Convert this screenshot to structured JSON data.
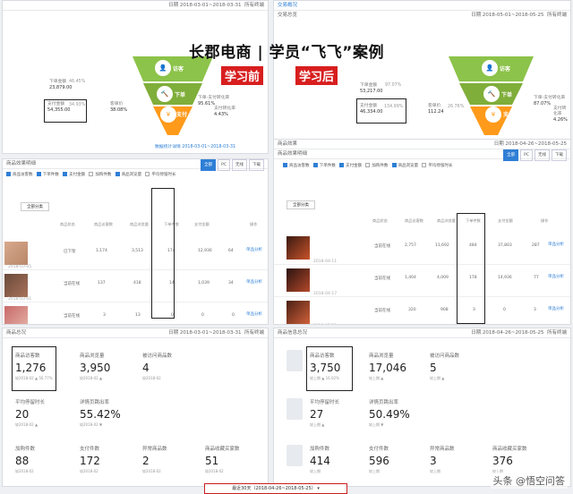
{
  "colors": {
    "funnel_top": "#8cc34a",
    "funnel_mid": "#7fae3a",
    "funnel_bot": "#ff9a1a",
    "accent": "#2f7fd6",
    "tag": "#d81e1e"
  },
  "banner": {
    "title": "长郡电商 | 学员“飞飞”案例",
    "before": "学习前",
    "after": "学习后",
    "watermark": "头条 @悟空问答"
  },
  "left": {
    "overview": {
      "date": "日期 2018-03-01~2018-03-31",
      "scope": "所有终端",
      "metrics": [
        {
          "label": "下单金额",
          "value": "23,879.00",
          "pct": "46.45%"
        },
        {
          "label": "支付金额",
          "value": "54,355.00",
          "pct": "34.93%"
        },
        {
          "label": "客单价",
          "value": "38.08%"
        },
        {
          "label": "下单-支付转化率",
          "value": "95.61%"
        },
        {
          "label": "支付转化率",
          "value": "4.43%"
        }
      ],
      "stages": [
        "访客",
        "下单",
        "支付"
      ],
      "compare_link": "数据统计详情 2018-03-01~2018-03-31"
    },
    "products": {
      "section": "商品效果明细",
      "tabs": [
        "全部",
        "PC",
        "无线",
        "下载"
      ],
      "filters": [
        "商品访客数",
        "下单件数",
        "支付金额",
        "加购件数",
        "商品浏览量",
        "平均停留时长"
      ],
      "sort": "全部分类",
      "headers": [
        "商品状态",
        "商品访客数",
        "商品浏览量",
        "下单件数",
        "支付金额",
        "操作"
      ],
      "rows": [
        {
          "status": "已下架",
          "a": "1,174",
          "b": "3,513",
          "c": "174",
          "d": "12,936",
          "e": "64",
          "act": "单品分析",
          "date": "2018-03-05"
        },
        {
          "status": "当前在线",
          "a": "137",
          "b": "418",
          "c": "14",
          "d": "1,039",
          "e": "34",
          "act": "单品分析",
          "date": "2018-03-01"
        },
        {
          "status": "当前在线",
          "a": "3",
          "b": "13",
          "c": "0",
          "d": "0",
          "e": "0",
          "act": "单品分析",
          "date": "2018-03-26"
        }
      ]
    },
    "summary": {
      "section": "商品总况",
      "date": "日期 2018-03-01~2018-03-31",
      "scope": "所有终端",
      "cells": [
        {
          "label": "商品访客数",
          "value": "1,276",
          "sub": "较2018-02 ▲ 56.77%"
        },
        {
          "label": "商品浏览量",
          "value": "3,950",
          "sub": "较2018-02 ▲"
        },
        {
          "label": "被访问商品数",
          "value": "4",
          "sub": "较2018-02"
        },
        {
          "label": "平均停留时长",
          "value": "20",
          "sub": "较2018-02 ▲"
        },
        {
          "label": "详情页跳出率",
          "value": "55.42%",
          "sub": "较2018-02 ▼"
        },
        {
          "label": "加购件数",
          "value": "88",
          "sub": "较2018-02"
        },
        {
          "label": "支付件数",
          "value": "172",
          "sub": "较2018-02"
        },
        {
          "label": "异常商品数",
          "value": "2",
          "sub": "较2018-02"
        },
        {
          "label": "商品收藏买家数",
          "value": "51",
          "sub": "较2018-02"
        }
      ]
    }
  },
  "right": {
    "overview": {
      "title": "交易概况",
      "section": "交易总览",
      "date": "日期 2018-05-01~2018-05-25",
      "scope": "所有终端",
      "metrics": [
        {
          "label": "下单金额",
          "value": "53,217.00",
          "pct": "97.07%"
        },
        {
          "label": "支付金额",
          "value": "46,334.00",
          "pct": "134.99%"
        },
        {
          "label": "客单价",
          "value": "112.24",
          "pct": "26.76%"
        },
        {
          "label": "下单-支付转化率",
          "value": "87.07%"
        },
        {
          "label": "支付转化率",
          "value": "4.26%"
        }
      ],
      "stages": [
        "访客",
        "下单",
        "支付"
      ]
    },
    "products": {
      "section": "商品效果",
      "subsection": "商品效果明细",
      "date": "日期 2018-04-26~2018-05-25",
      "tabs": [
        "全部",
        "PC",
        "无线",
        "下载"
      ],
      "filters": [
        "商品访客数",
        "下单件数",
        "支付金额",
        "加购件数",
        "商品浏览量",
        "平均停留时长"
      ],
      "sort": "全部分类",
      "headers": [
        "商品状态",
        "商品访客数",
        "商品浏览量",
        "下单件数",
        "支付金额",
        "操作"
      ],
      "rows": [
        {
          "status": "当前在线",
          "a": "2,757",
          "b": "11,692",
          "c": "484",
          "d": "37,803",
          "e": "287",
          "act": "单品分析",
          "date": "2018-04-11"
        },
        {
          "status": "当前在线",
          "a": "1,404",
          "b": "4,009",
          "c": "178",
          "d": "14,936",
          "e": "77",
          "act": "单品分析",
          "date": "2018-04-17"
        },
        {
          "status": "当前在线",
          "a": "320",
          "b": "908",
          "c": "3",
          "d": "0",
          "e": "3",
          "act": "单品分析",
          "date": "2018-05-23"
        }
      ]
    },
    "summary": {
      "section": "商品信息总况",
      "date": "日期 2018-04-26~2018-05-25",
      "scope": "所有终端",
      "cells": [
        {
          "label": "商品访客数",
          "value": "3,750",
          "sub": "较上期 ▲ 16.02%"
        },
        {
          "label": "商品浏览量",
          "value": "17,046",
          "sub": "较上期 ▲"
        },
        {
          "label": "被访问商品数",
          "value": "5",
          "sub": "较上期 ▲"
        },
        {
          "label": "平均停留时长",
          "value": "27",
          "sub": "较上期 ▲"
        },
        {
          "label": "详情页跳出率",
          "value": "50.49%",
          "sub": "较上期 ▼"
        },
        {
          "label": "加购件数",
          "value": "414",
          "sub": "较上期"
        },
        {
          "label": "支付件数",
          "value": "596",
          "sub": "较上期"
        },
        {
          "label": "异常商品数",
          "value": "3",
          "sub": "较上期"
        },
        {
          "label": "商品收藏买家数",
          "value": "376",
          "sub": "较上期"
        }
      ]
    },
    "range_button": "最近30天（2018-04-26~2018-05-25）"
  }
}
